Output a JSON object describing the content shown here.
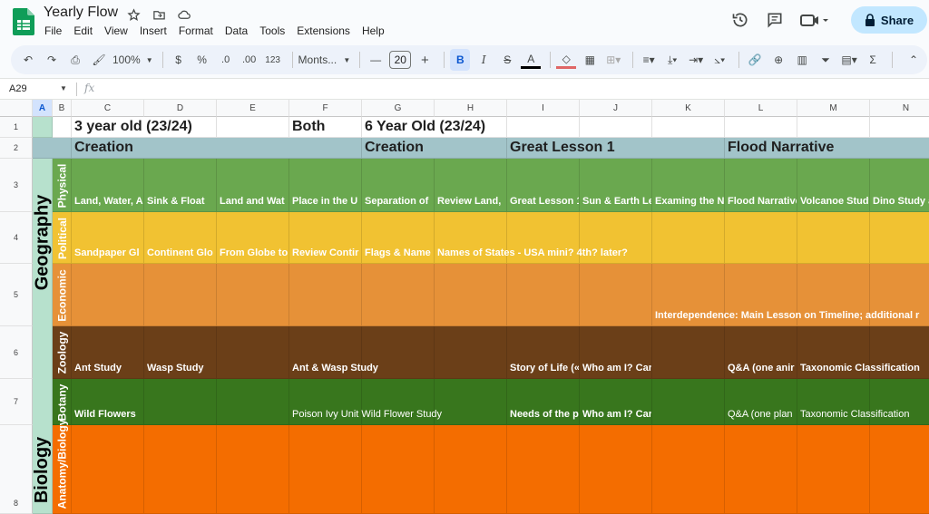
{
  "app": {
    "title": "Yearly Flow",
    "share_label": "Share"
  },
  "menu": [
    "File",
    "Edit",
    "View",
    "Insert",
    "Format",
    "Data",
    "Tools",
    "Extensions",
    "Help"
  ],
  "toolbar": {
    "zoom": "100%",
    "currency": "$",
    "percent": "%",
    "dec_less": ".0",
    "dec_more": ".00",
    "format123": "123",
    "font": "Monts...",
    "font_size": "20"
  },
  "formula_bar": {
    "cell_ref": "A29",
    "fx": "fx"
  },
  "colors": {
    "header_row": "#a2c4c9",
    "physical": "#6aa84f",
    "political": "#f1c232",
    "economic": "#e69138",
    "zoology": "#6b3f18",
    "botany": "#38761d",
    "anatomy": "#f46d00",
    "col_a": "#b7e1cd",
    "share": "#c2e7ff"
  },
  "columns": [
    "A",
    "B",
    "C",
    "D",
    "E",
    "F",
    "G",
    "H",
    "I",
    "J",
    "K",
    "L",
    "M",
    "N"
  ],
  "rows": [
    "1",
    "2",
    "3",
    "4",
    "5",
    "6",
    "7",
    "8"
  ],
  "row1": {
    "c": "3 year old (23/24)",
    "f": "Both",
    "g": "6 Year Old (23/24)"
  },
  "row2": {
    "c": "Creation",
    "g": "Creation",
    "i": "Great Lesson 1",
    "l": "Flood Narrative"
  },
  "side_labels": {
    "geography": "Geography",
    "biology": "Biology",
    "physical": "Physical",
    "political": "Political",
    "economic": "Economic",
    "zoology": "Zoology",
    "botany": "Botany",
    "anatomy": "Anatomy/Biology"
  },
  "row3": {
    "c": "Land, Water, A",
    "d": "Sink & Float",
    "e": "Land and Wat",
    "f": "Place in the U",
    "g": "Separation of",
    "h": "Review Land, ",
    "i": "Great Lesson 1",
    "j": "Sun & Earth Les",
    "k": "Examing the Na",
    "l": "Flood Narrative",
    "m": "Volcanoe Study",
    "n": "Dino Study ar"
  },
  "row4": {
    "c": "Sandpaper Gl",
    "d": "Continent Glo",
    "e": "From Globe to",
    "f": "Review Contir",
    "g": "Flags & Name",
    "h": "Names of States - USA mini? 4th? later?"
  },
  "row5": {
    "k": "Interdependence: Main Lesson on Timeline; additional r"
  },
  "row6": {
    "c": "Ant Study",
    "d": "Wasp Study",
    "f": "Ant & Wasp Study",
    "i": "Story of Life («",
    "j": "Who am I? Cards",
    "l": "Q&A (one anir",
    "m": "Taxonomic Classification"
  },
  "row7": {
    "c": "Wild Flowers",
    "f": "Poison Ivy Unit Wild Flower Study",
    "i": "Needs of the p",
    "j": "Who am I? Cards",
    "l": "Q&A (one plan",
    "m": "Taxonomic Classification"
  }
}
